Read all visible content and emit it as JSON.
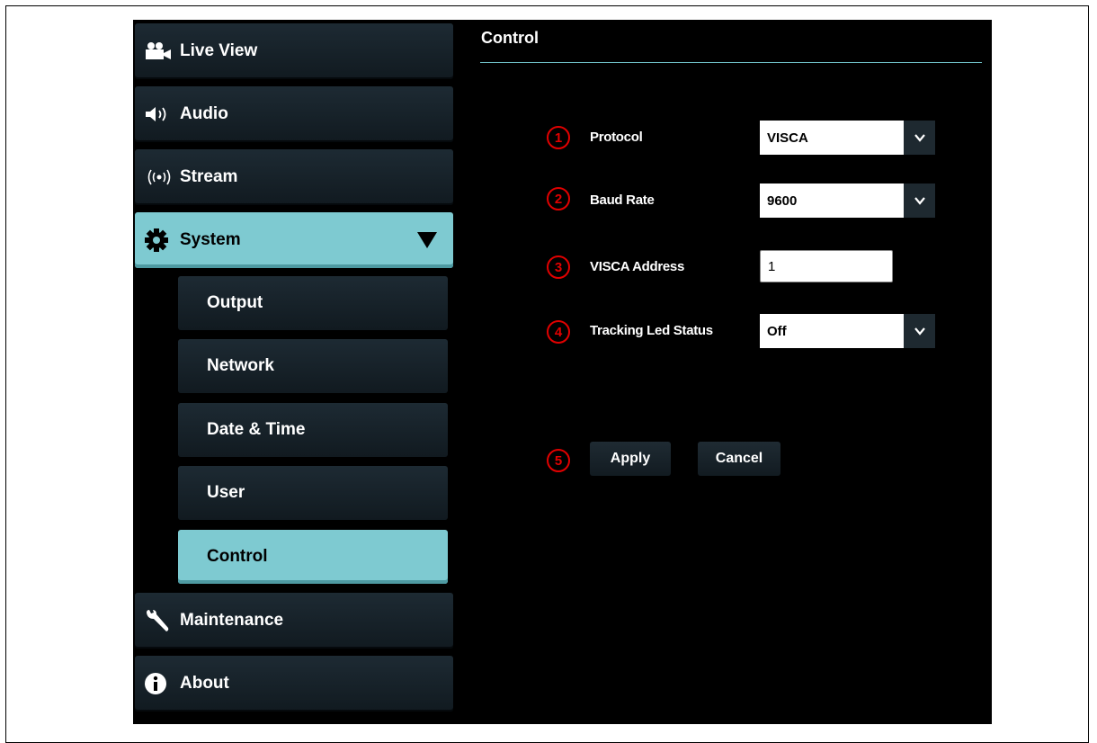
{
  "sidebar": {
    "items": [
      {
        "label": "Live View",
        "icon": "video-camera-icon"
      },
      {
        "label": "Audio",
        "icon": "speaker-icon"
      },
      {
        "label": "Stream",
        "icon": "broadcast-icon"
      },
      {
        "label": "System",
        "icon": "gear-icon",
        "expanded": true
      },
      {
        "label": "Maintenance",
        "icon": "wrench-icon"
      },
      {
        "label": "About",
        "icon": "info-icon"
      }
    ],
    "system_sub": [
      {
        "label": "Output"
      },
      {
        "label": "Network"
      },
      {
        "label": "Date & Time"
      },
      {
        "label": "User"
      },
      {
        "label": "Control",
        "active": true
      }
    ]
  },
  "main": {
    "title": "Control",
    "fields": {
      "protocol": {
        "marker": "1",
        "label": "Protocol",
        "value": "VISCA"
      },
      "baud_rate": {
        "marker": "2",
        "label": "Baud Rate",
        "value": "9600"
      },
      "visca_address": {
        "marker": "3",
        "label": "VISCA Address",
        "value": "1"
      },
      "tracking_led": {
        "marker": "4",
        "label": "Tracking Led Status",
        "value": "Off"
      }
    },
    "actions": {
      "marker": "5",
      "apply_label": "Apply",
      "cancel_label": "Cancel"
    }
  },
  "colors": {
    "accent": "#7ecad1",
    "marker": "#e10000",
    "background": "#000000"
  }
}
